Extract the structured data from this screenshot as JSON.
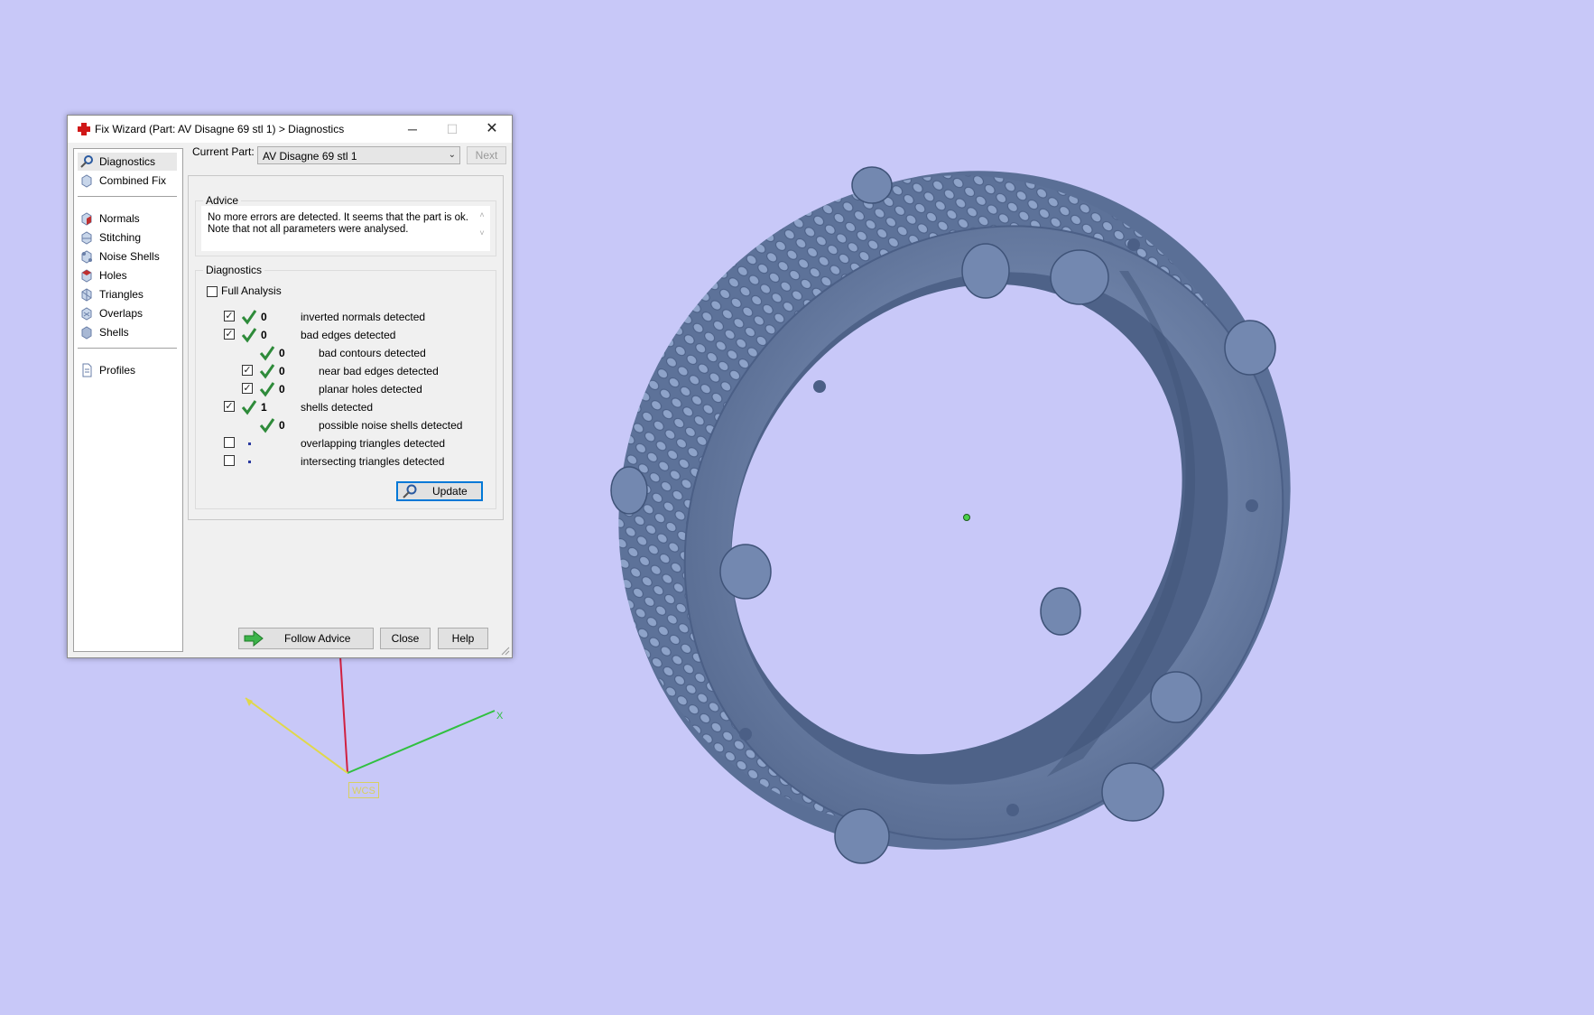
{
  "window": {
    "title": "Fix Wizard (Part: AV Disagne 69 stl 1) > Diagnostics",
    "minimize": "─",
    "maximize": "☐",
    "close": "✕"
  },
  "nav": {
    "items": [
      {
        "label": "Diagnostics"
      },
      {
        "label": "Combined Fix"
      },
      {
        "label": "Normals"
      },
      {
        "label": "Stitching"
      },
      {
        "label": "Noise Shells"
      },
      {
        "label": "Holes"
      },
      {
        "label": "Triangles"
      },
      {
        "label": "Overlaps"
      },
      {
        "label": "Shells"
      },
      {
        "label": "Profiles"
      }
    ]
  },
  "current_part": {
    "label": "Current Part:",
    "value": "AV Disagne 69 stl 1",
    "next_label": "Next"
  },
  "advice": {
    "title": "Advice",
    "line1": "No more errors are detected. It seems that the part is ok.",
    "line2": "Note that not all parameters were analysed."
  },
  "diagnostics": {
    "title": "Diagnostics",
    "full_analysis_label": "Full Analysis",
    "rows": [
      {
        "checked": true,
        "count": "0",
        "text": "inverted normals detected"
      },
      {
        "checked": true,
        "count": "0",
        "text": "bad edges detected"
      },
      {
        "checked": null,
        "count": "0",
        "text": "bad contours detected"
      },
      {
        "checked": true,
        "count": "0",
        "text": "near bad edges detected"
      },
      {
        "checked": true,
        "count": "0",
        "text": "planar holes detected"
      },
      {
        "checked": true,
        "count": "1",
        "text": "shells detected"
      },
      {
        "checked": null,
        "count": "0",
        "text": "possible noise shells detected"
      },
      {
        "checked": false,
        "count": "",
        "text": "overlapping triangles detected"
      },
      {
        "checked": false,
        "count": "",
        "text": "intersecting triangles detected"
      }
    ],
    "update_label": "Update"
  },
  "buttons": {
    "follow_advice": "Follow Advice",
    "close": "Close",
    "help": "Help"
  },
  "axes": {
    "x_label": "X",
    "wcs_label": "WCS"
  },
  "colors": {
    "background": "#c8c8f8",
    "model": "#6a7fa8",
    "check_green": "#2e8b3a",
    "update_border": "#0078d7"
  }
}
